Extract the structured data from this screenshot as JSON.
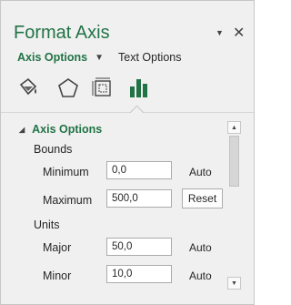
{
  "pane": {
    "title": "Format Axis",
    "pin_icon": "dropdown-triangle",
    "close_icon": "close-x"
  },
  "option_tabs": {
    "main": "Axis Options",
    "secondary": "Text Options"
  },
  "icon_tabs": [
    {
      "name": "fill-line-icon"
    },
    {
      "name": "effects-pentagon-icon"
    },
    {
      "name": "size-properties-icon"
    },
    {
      "name": "axis-options-bar-chart-icon",
      "selected": true
    }
  ],
  "section": {
    "title": "Axis Options",
    "bounds_label": "Bounds",
    "minimum_label": "Minimum",
    "minimum_value": "0,0",
    "minimum_state": "Auto",
    "maximum_label": "Maximum",
    "maximum_value": "500,0",
    "maximum_action": "Reset",
    "units_label": "Units",
    "major_label": "Major",
    "major_value": "50,0",
    "major_state": "Auto",
    "minor_label": "Minor",
    "minor_value": "10,0",
    "minor_state": "Auto"
  },
  "colors": {
    "accent": "#217346",
    "pane_bg": "#f0f0f0"
  }
}
